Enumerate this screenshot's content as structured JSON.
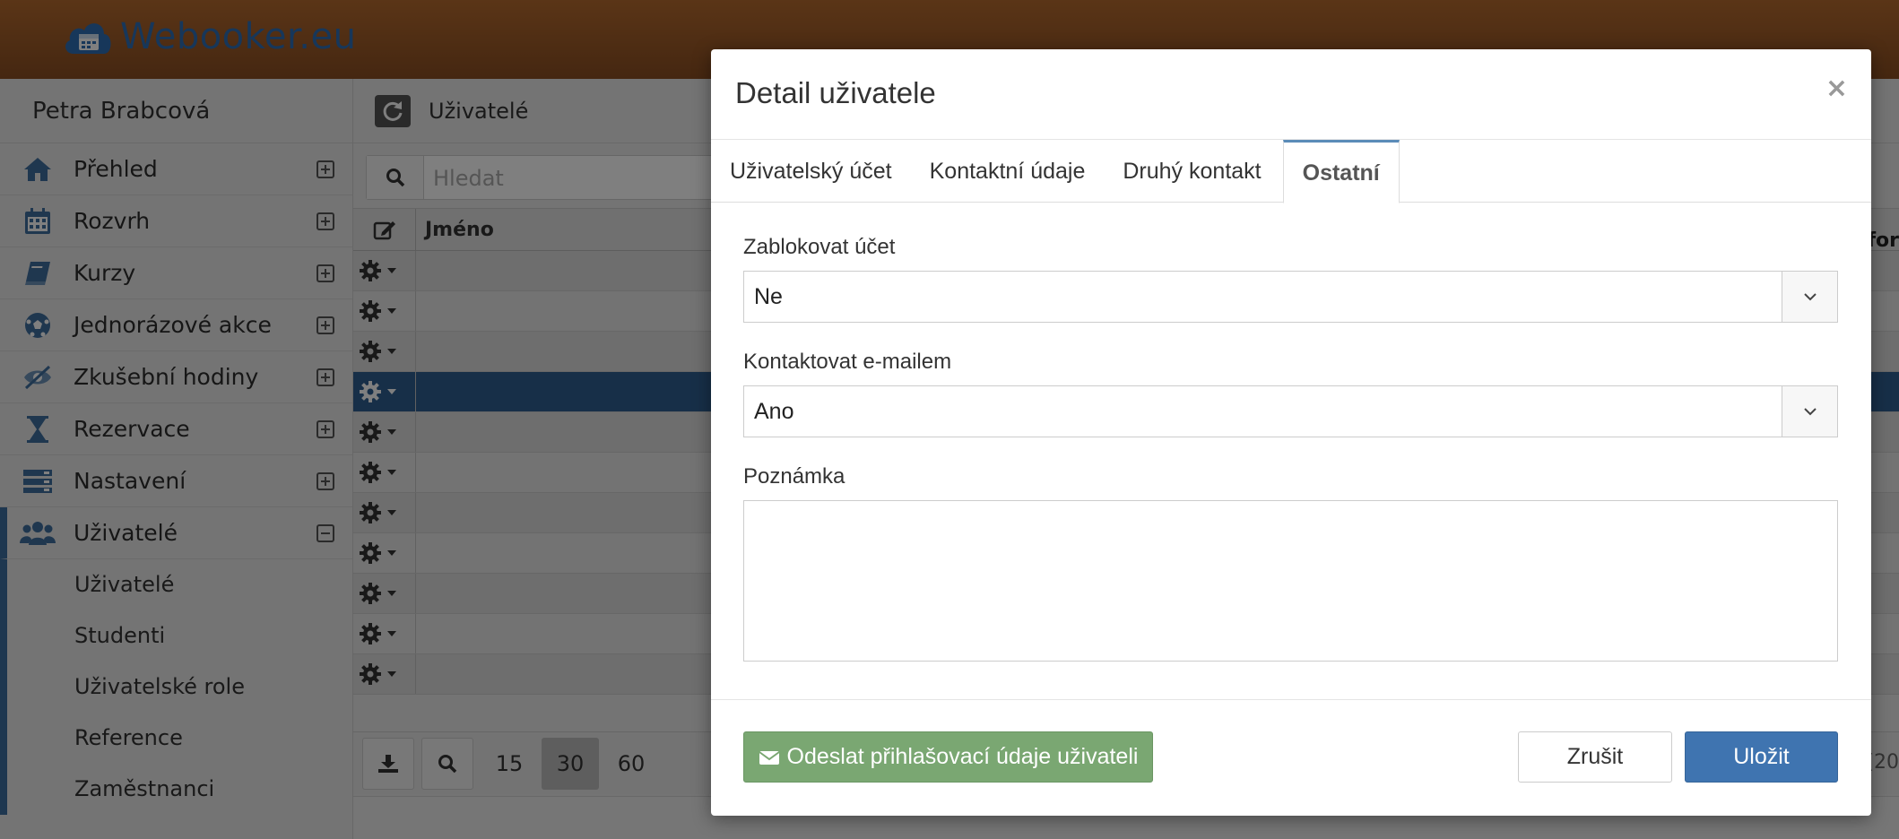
{
  "app": {
    "brand": "Webooker.eu"
  },
  "sidebar": {
    "user_name": "Petra Brabcová",
    "items": [
      {
        "label": "Přehled",
        "icon": "home-icon"
      },
      {
        "label": "Rozvrh",
        "icon": "calendar-icon"
      },
      {
        "label": "Kurzy",
        "icon": "book-icon"
      },
      {
        "label": "Jednorázové akce",
        "icon": "soccer-ball-icon"
      },
      {
        "label": "Zkušební hodiny",
        "icon": "eye-slash-icon"
      },
      {
        "label": "Rezervace",
        "icon": "hourglass-icon"
      },
      {
        "label": "Nastavení",
        "icon": "server-icon"
      },
      {
        "label": "Uživatelé",
        "icon": "users-icon"
      }
    ],
    "subitems": [
      "Uživatelé",
      "Studenti",
      "Uživatelské role",
      "Reference",
      "Zaměstnanci"
    ]
  },
  "main": {
    "title": "Uživatelé",
    "search_placeholder": "Hledat",
    "column_name": "Jméno",
    "page_sizes": [
      "15",
      "30",
      "60"
    ],
    "current_page_size": "30",
    "edge_header": "for",
    "edge_footer": "(20"
  },
  "modal": {
    "title": "Detail uživatele",
    "close": "×",
    "tabs": [
      "Uživatelský účet",
      "Kontaktní údaje",
      "Druhý kontakt",
      "Ostatní"
    ],
    "active_tab": "Ostatní",
    "fields": {
      "block_label": "Zablokovat účet",
      "block_value": "Ne",
      "contact_label": "Kontaktovat e-mailem",
      "contact_value": "Ano",
      "note_label": "Poznámka",
      "note_value": ""
    },
    "buttons": {
      "send": "Odeslat přihlašovací údaje uživateli",
      "cancel": "Zrušit",
      "save": "Uložit"
    }
  },
  "colors": {
    "topbar": "#9d5b27",
    "brand": "#2f6eb5",
    "send_button": "#7aa772",
    "save_button": "#3f74b0",
    "selected_row": "#2f5f91"
  }
}
